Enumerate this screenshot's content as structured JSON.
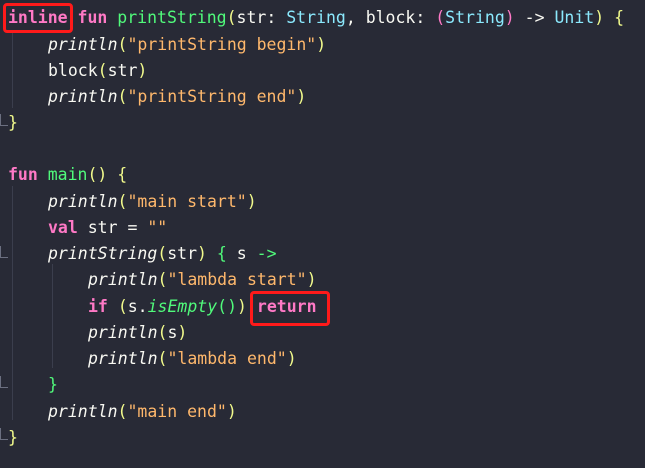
{
  "code": {
    "l1": {
      "kw_inline": "inline",
      "kw_fun": "fun",
      "fn_name": "printString",
      "p_open": "(",
      "param_str": "str",
      "colon1": ": ",
      "type_string": "String",
      "comma": ", ",
      "param_block": "block",
      "colon2": ": ",
      "t_open": "(",
      "type_string2": "String",
      "t_close": ")",
      "arrow": " -> ",
      "type_unit": "Unit",
      "p_close": ")",
      "brace": " {"
    },
    "l2": {
      "call": "println",
      "open": "(",
      "str": "\"printString begin\"",
      "close": ")"
    },
    "l3": {
      "text": "block",
      "open": "(",
      "arg": "str",
      "close": ")"
    },
    "l4": {
      "call": "println",
      "open": "(",
      "str": "\"printString end\"",
      "close": ")"
    },
    "l5": {
      "brace": "}"
    },
    "l7": {
      "kw_fun": "fun",
      "fn_name": "main",
      "parens": "()",
      "brace": " {"
    },
    "l8": {
      "call": "println",
      "open": "(",
      "str": "\"main start\"",
      "close": ")"
    },
    "l9": {
      "kw_val": "val",
      "rest": " str = ",
      "str": "\"\""
    },
    "l10": {
      "call": "printString",
      "open": "(",
      "arg": "str",
      "close": ")",
      "brace": " { ",
      "param": "s",
      "arrow": " ->"
    },
    "l11": {
      "call": "println",
      "open": "(",
      "str": "\"lambda start\"",
      "close": ")"
    },
    "l12": {
      "kw_if": "if",
      "sp": " ",
      "open": "(",
      "recv": "s.",
      "call": "isEmpty",
      "parens": "()",
      "close": ")",
      "kw_return": "return"
    },
    "l13": {
      "call": "println",
      "open": "(",
      "arg": "s",
      "close": ")"
    },
    "l14": {
      "call": "println",
      "open": "(",
      "str": "\"lambda end\"",
      "close": ")"
    },
    "l15": {
      "brace": "}"
    },
    "l16": {
      "call": "println",
      "open": "(",
      "str": "\"main end\"",
      "close": ")"
    },
    "l17": {
      "brace": "}"
    }
  },
  "highlight_color": "#ff1a1a",
  "background_color": "#282a36"
}
